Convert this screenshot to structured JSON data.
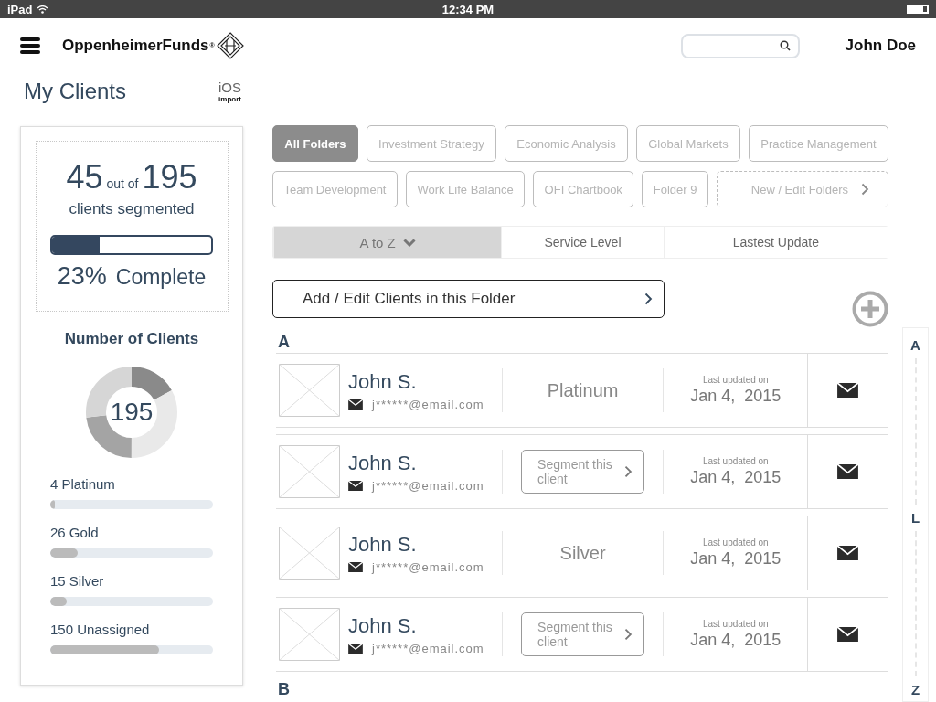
{
  "status_bar": {
    "device": "iPad",
    "time": "12:34 PM"
  },
  "header": {
    "brand": "OppenheimerFunds",
    "brand_mark": "®",
    "user": "John Doe"
  },
  "page_title": "My Clients",
  "import_badge": {
    "label": "iOS",
    "sublabel": "import"
  },
  "summary": {
    "segmented": "45",
    "out_of": "out of",
    "total": "195",
    "caption": "clients segmented",
    "progress": {
      "level": 0.3
    },
    "percent": "23%",
    "complete_label": "Complete"
  },
  "number_of_clients": {
    "title": "Number of Clients",
    "total": "195",
    "levels": [
      {
        "label": "4 Platinum",
        "level": 0.03
      },
      {
        "label": "26 Gold",
        "level": 0.17
      },
      {
        "label": "15 Silver",
        "level": 0.1
      },
      {
        "label": "150 Unassigned",
        "level": 0.67
      }
    ]
  },
  "folder_rows": [
    {
      "items": [
        {
          "label": "All Folders",
          "selected": true
        },
        {
          "label": "Investment Strategy",
          "selected": false
        },
        {
          "label": "Economic Analysis",
          "selected": false
        },
        {
          "label": "Global Markets",
          "selected": false
        },
        {
          "label": "Practice Management",
          "selected": false
        }
      ]
    },
    {
      "items": [
        {
          "label": "Team Development",
          "selected": false
        },
        {
          "label": "Work Life Balance",
          "selected": false
        },
        {
          "label": "OFI Chartbook",
          "selected": false
        },
        {
          "label": "Folder 9",
          "selected": false
        }
      ]
    }
  ],
  "folder_action": "New / Edit Folders",
  "sort_tabs": [
    {
      "label": "A to Z",
      "selected": true
    },
    {
      "label": "Service Level",
      "selected": false
    },
    {
      "label": "Lastest Update",
      "selected": false
    }
  ],
  "add_clients_button": "Add / Edit Clients in this Folder",
  "sections": [
    {
      "letter": "A",
      "clients": [
        {
          "name": "John S.",
          "email": "j******@email.com",
          "service": {
            "kind": "level",
            "label": "Platinum"
          },
          "updated_label": "Last updated on",
          "updated_date": "Jan 4,  2015"
        },
        {
          "name": "John S.",
          "email": "j******@email.com",
          "service": {
            "kind": "segment",
            "label": "Segment this client"
          },
          "updated_label": "Last updated on",
          "updated_date": "Jan 4,  2015"
        },
        {
          "name": "John S.",
          "email": "j******@email.com",
          "service": {
            "kind": "level",
            "label": "Silver"
          },
          "updated_label": "Last updated on",
          "updated_date": "Jan 4,  2015"
        },
        {
          "name": "John S.",
          "email": "j******@email.com",
          "service": {
            "kind": "segment",
            "label": "Segment this client"
          },
          "updated_label": "Last updated on",
          "updated_date": "Jan 4,  2015"
        }
      ]
    },
    {
      "letter": "B"
    }
  ],
  "alpha_index": [
    "A",
    "L",
    "Z"
  ]
}
